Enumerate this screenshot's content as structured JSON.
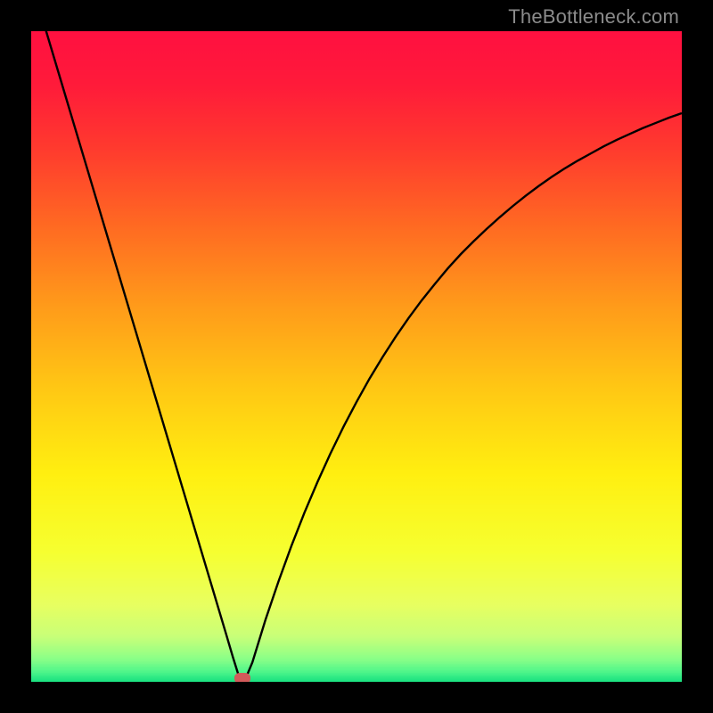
{
  "watermark": "TheBottleneck.com",
  "colors": {
    "frame": "#000000",
    "curve": "#000000",
    "dot": "#d25a5a",
    "watermark": "#8b8b8b"
  },
  "chart_data": {
    "type": "line",
    "title": "",
    "xlabel": "",
    "ylabel": "",
    "xlim": [
      0,
      100
    ],
    "ylim": [
      0,
      100
    ],
    "grid": false,
    "legend": false,
    "x": [
      0,
      2,
      4,
      6,
      8,
      10,
      12,
      14,
      16,
      18,
      20,
      22,
      24,
      26,
      28,
      30,
      31,
      32,
      33,
      34,
      36,
      38,
      40,
      42,
      44,
      46,
      48,
      50,
      52,
      54,
      56,
      58,
      60,
      62,
      64,
      66,
      68,
      70,
      72,
      74,
      76,
      78,
      80,
      82,
      84,
      86,
      88,
      90,
      92,
      94,
      96,
      98,
      100
    ],
    "values": [
      108,
      101,
      94.3,
      87.6,
      80.9,
      74.2,
      67.5,
      60.8,
      54.1,
      47.4,
      40.7,
      34.0,
      27.3,
      20.6,
      13.9,
      7.2,
      3.8,
      0.6,
      0.6,
      3.0,
      9.5,
      15.4,
      20.9,
      26.0,
      30.7,
      35.1,
      39.2,
      43.0,
      46.6,
      49.9,
      53.0,
      55.9,
      58.6,
      61.1,
      63.5,
      65.7,
      67.7,
      69.6,
      71.4,
      73.1,
      74.7,
      76.2,
      77.6,
      78.9,
      80.1,
      81.2,
      82.3,
      83.3,
      84.2,
      85.1,
      85.9,
      86.7,
      87.4
    ],
    "marker": {
      "x": 32.5,
      "y": 0.6
    },
    "background_gradient": [
      {
        "stop": 0.0,
        "color": "#ff1040"
      },
      {
        "stop": 0.08,
        "color": "#ff1a3a"
      },
      {
        "stop": 0.18,
        "color": "#ff3a2e"
      },
      {
        "stop": 0.3,
        "color": "#ff6a22"
      },
      {
        "stop": 0.42,
        "color": "#ff9a1a"
      },
      {
        "stop": 0.55,
        "color": "#ffc814"
      },
      {
        "stop": 0.68,
        "color": "#ffef10"
      },
      {
        "stop": 0.8,
        "color": "#f6ff30"
      },
      {
        "stop": 0.88,
        "color": "#e8ff60"
      },
      {
        "stop": 0.93,
        "color": "#c8ff78"
      },
      {
        "stop": 0.965,
        "color": "#8aff88"
      },
      {
        "stop": 0.985,
        "color": "#4cf58a"
      },
      {
        "stop": 1.0,
        "color": "#16e080"
      }
    ]
  }
}
